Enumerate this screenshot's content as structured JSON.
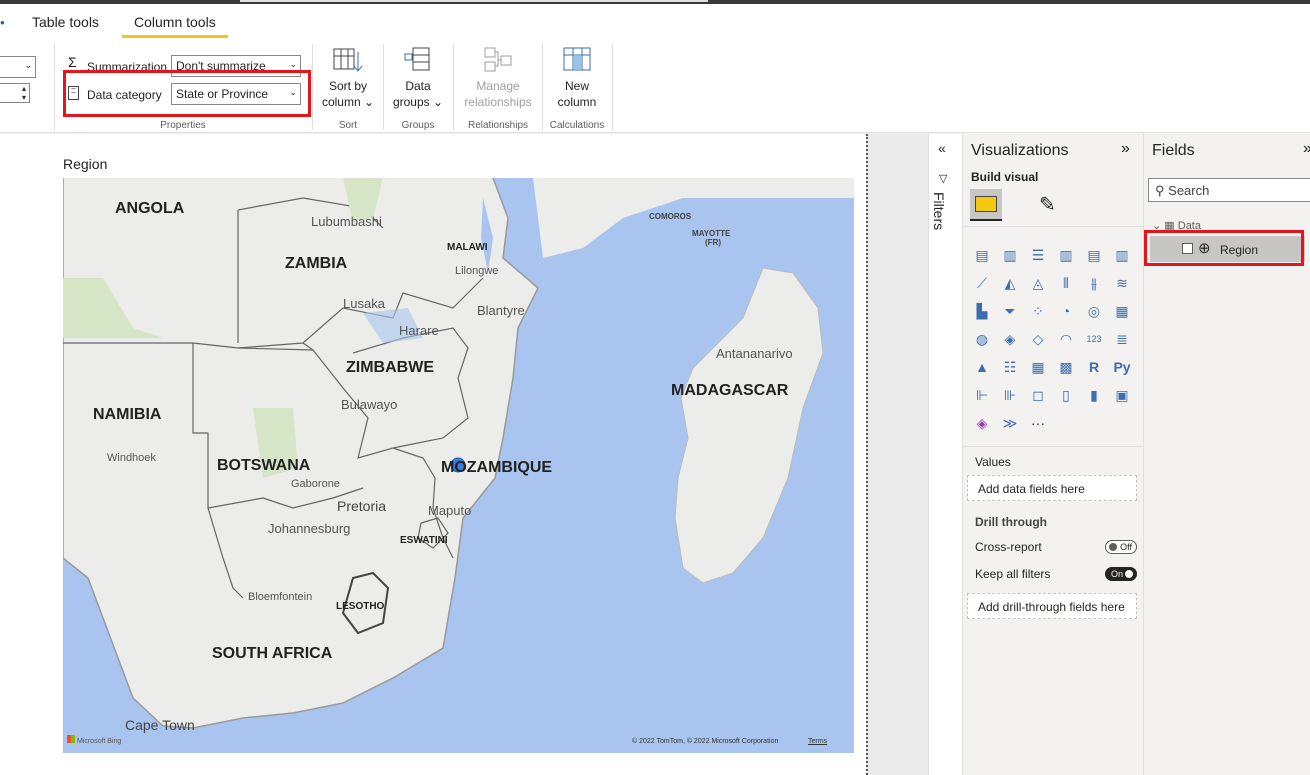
{
  "tabs": [
    {
      "label": "Table tools"
    },
    {
      "label": "Column tools"
    }
  ],
  "ribbon": {
    "summarization_label": "Summarization",
    "summarization_value": "Don't summarize",
    "data_category_label": "Data category",
    "data_category_value": "State or Province",
    "properties_label": "Properties",
    "sort_by_column": [
      "Sort by",
      "column"
    ],
    "sort_label": "Sort",
    "data_groups": [
      "Data",
      "groups"
    ],
    "groups_label": "Groups",
    "manage_relationships": [
      "Manage",
      "relationships"
    ],
    "relationships_label": "Relationships",
    "new_column": [
      "New",
      "column"
    ],
    "calculations_label": "Calculations"
  },
  "visual": {
    "title": "Region",
    "map": {
      "countries": [
        "ANGOLA",
        "ZAMBIA",
        "MALAWI",
        "ZIMBABWE",
        "NAMIBIA",
        "BOTSWANA",
        "MOZAMBIQUE",
        "MADAGASCAR",
        "SOUTH AFRICA",
        "ESWATINI",
        "LESOTHO"
      ],
      "cities": [
        "Lubumbashi",
        "Lusaka",
        "Lilongwe",
        "Blantyre",
        "Harare",
        "Bulawayo",
        "Windhoek",
        "Gaborone",
        "Pretoria",
        "Johannesburg",
        "Maputo",
        "Bloemfontein",
        "Cape Town",
        "Antananarivo"
      ],
      "islands": [
        "COMOROS",
        "MAYOTTE",
        "(FR)"
      ],
      "logo": "Microsoft Bing",
      "copyright": "© 2022 TomTom, © 2022 Microsoft Corporation",
      "terms": "Terms"
    }
  },
  "filters": {
    "label": "Filters"
  },
  "visualizations": {
    "title": "Visualizations",
    "build_visual": "Build visual",
    "values_label": "Values",
    "values_placeholder": "Add data fields here",
    "drill_through_label": "Drill through",
    "cross_report_label": "Cross-report",
    "cross_report_state": "Off",
    "keep_filters_label": "Keep all filters",
    "keep_filters_state": "On",
    "drill_placeholder": "Add drill-through fields here",
    "more": "···"
  },
  "fields": {
    "title": "Fields",
    "search_placeholder": "Search",
    "table_name": "Data",
    "field_name": "Region"
  },
  "colors": {
    "accent_yellow": "#f2c811",
    "highlight_red": "#e3161e",
    "map_water": "#a9c4ef",
    "map_land": "#ececea"
  }
}
